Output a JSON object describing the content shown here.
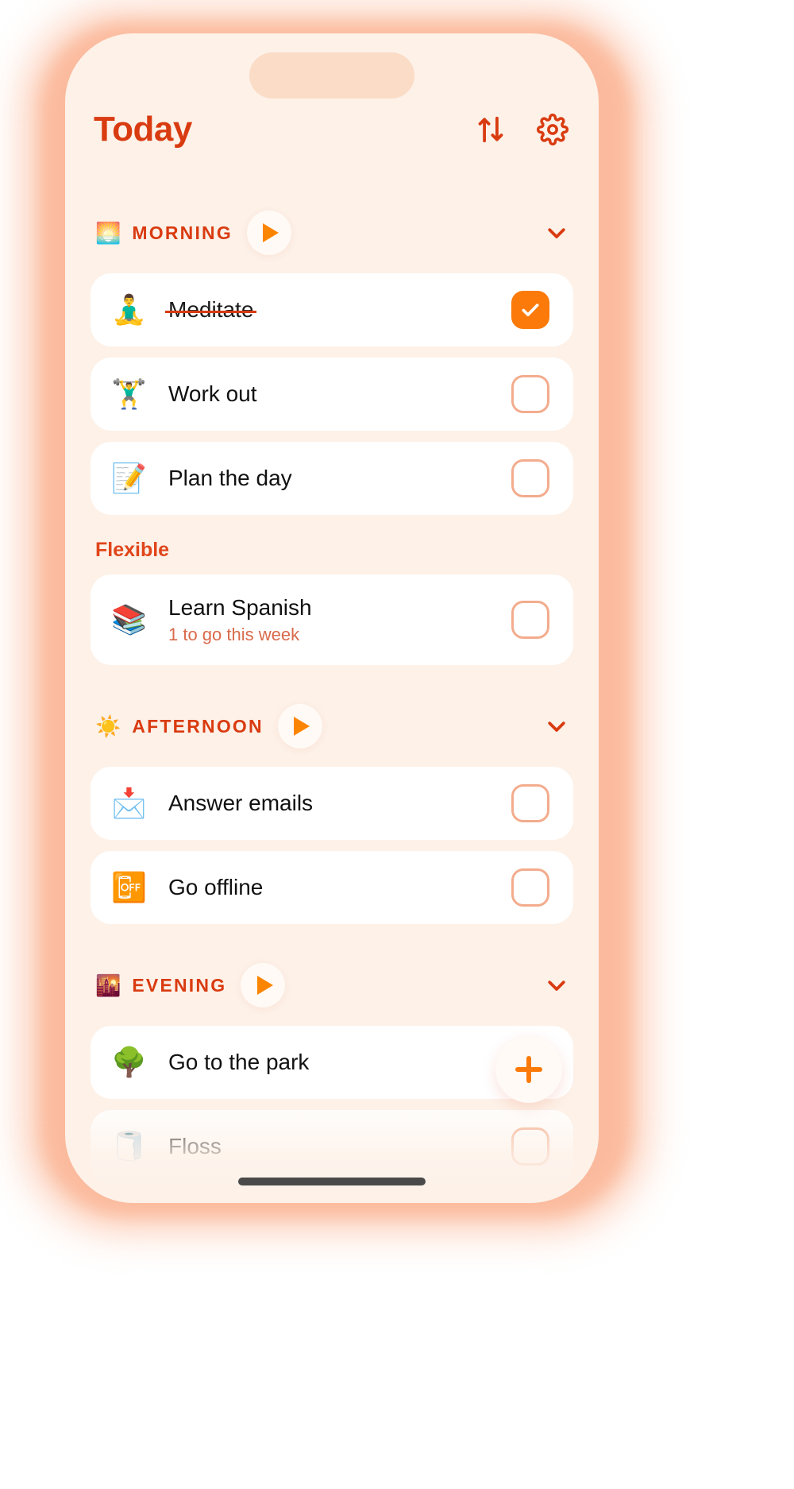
{
  "header": {
    "title": "Today",
    "sort_icon": "sort-arrows-icon",
    "settings_icon": "gear-icon"
  },
  "colors": {
    "brand": "#d93b10",
    "accent": "#fb7a09",
    "background": "#fdf1e8",
    "card": "#ffffff",
    "checkbox_outline": "#f3ac8d",
    "subtitle": "#d96a4a",
    "glow": "#fcc6ac",
    "notch": "#fbdcc6"
  },
  "sections": [
    {
      "id": "morning",
      "emoji": "🌅",
      "emoji_name": "sunrise-icon",
      "label": "MORNING",
      "play_label": "Start morning routine",
      "tasks": [
        {
          "emoji": "🧘‍♂️",
          "emoji_name": "person-meditating-icon",
          "title": "Meditate",
          "done": true
        },
        {
          "emoji": "🏋️‍♂️",
          "emoji_name": "weight-lifter-icon",
          "title": "Work out",
          "done": false
        },
        {
          "emoji": "📝",
          "emoji_name": "memo-icon",
          "title": "Plan the day",
          "done": false
        }
      ],
      "subgroup": {
        "label": "Flexible",
        "tasks": [
          {
            "emoji": "📚",
            "emoji_name": "books-icon",
            "title": "Learn Spanish",
            "subtitle": "1 to go this week",
            "done": false
          }
        ]
      }
    },
    {
      "id": "afternoon",
      "emoji": "☀️",
      "emoji_name": "sun-icon",
      "label": "AFTERNOON",
      "play_label": "Start afternoon routine",
      "tasks": [
        {
          "emoji": "📩",
          "emoji_name": "envelope-with-arrow-icon",
          "title": "Answer emails",
          "done": false
        },
        {
          "emoji": "📴",
          "emoji_name": "mobile-phone-off-icon",
          "title": "Go offline",
          "done": false
        }
      ]
    },
    {
      "id": "evening",
      "emoji": "🌇",
      "emoji_name": "sunset-icon",
      "label": "EVENING",
      "play_label": "Start evening routine",
      "tasks": [
        {
          "emoji": "🌳",
          "emoji_name": "tree-icon",
          "title": "Go to the park",
          "done": false
        },
        {
          "emoji": "🧻",
          "emoji_name": "roll-of-paper-icon",
          "title": "Floss",
          "done": false
        }
      ]
    }
  ],
  "fab": {
    "label": "+",
    "name": "add-task-button"
  },
  "collapse_icon": "chevron-down-icon"
}
